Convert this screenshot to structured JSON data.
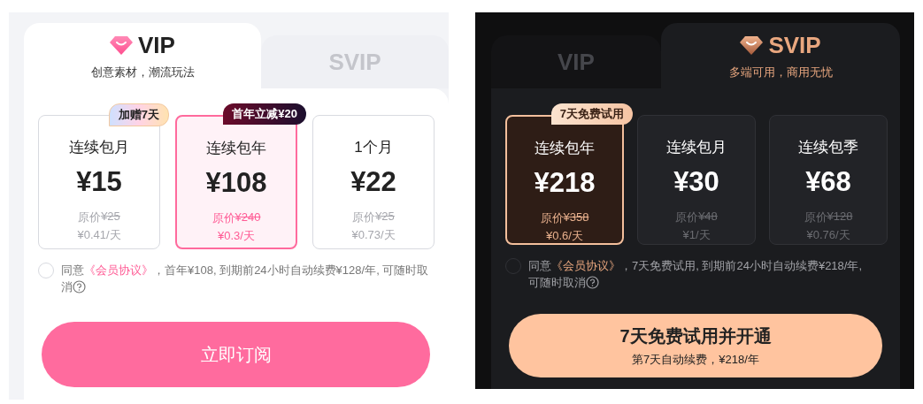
{
  "panels": [
    {
      "kind": "light",
      "tabs": [
        {
          "label": "VIP",
          "subtitle": "创意素材，潮流玩法",
          "selected": true
        },
        {
          "label": "SVIP",
          "selected": false
        }
      ],
      "plans": [
        {
          "name": "连续包月",
          "price": "¥15",
          "original_label": "原价",
          "original_price": "¥25",
          "daily": "¥0.41/天",
          "badge": {
            "kind": "gift",
            "text": "加赠7天"
          },
          "selected": false
        },
        {
          "name": "连续包年",
          "price": "¥108",
          "original_label": "原价",
          "original_price": "¥240",
          "daily": "¥0.3/天",
          "badge": {
            "kind": "discount",
            "text": "首年立减¥20"
          },
          "selected": true
        },
        {
          "name": "1个月",
          "price": "¥22",
          "original_label": "原价",
          "original_price": "¥25",
          "daily": "¥0.73/天",
          "selected": false
        }
      ],
      "agreement": {
        "checked": false,
        "prefix": "同意",
        "link": "《会员协议》",
        "suffix": "，首年¥108, 到期前24小时自动续费¥128/年, 可随时取消"
      },
      "button": {
        "label": "立即订阅"
      }
    },
    {
      "kind": "dark",
      "tabs": [
        {
          "label": "VIP",
          "selected": false
        },
        {
          "label": "SVIP",
          "subtitle": "多端可用，商用无忧",
          "selected": true
        }
      ],
      "plans": [
        {
          "name": "连续包年",
          "price": "¥218",
          "original_label": "原价",
          "original_price": "¥358",
          "daily": "¥0.6/天",
          "badge": {
            "kind": "trial",
            "text": "7天免费试用"
          },
          "selected": true
        },
        {
          "name": "连续包月",
          "price": "¥30",
          "original_label": "原价",
          "original_price": "¥48",
          "daily": "¥1/天",
          "selected": false
        },
        {
          "name": "连续包季",
          "price": "¥68",
          "original_label": "原价",
          "original_price": "¥128",
          "daily": "¥0.76/天",
          "selected": false
        }
      ],
      "agreement": {
        "checked": false,
        "prefix": "同意",
        "link": "《会员协议》",
        "suffix": "，7天免费试用, 到期前24小时自动续费¥218/年, 可随时取消"
      },
      "button": {
        "label": "7天免费试用并开通",
        "sublabel": "第7天自动续费，¥218/年"
      }
    }
  ]
}
